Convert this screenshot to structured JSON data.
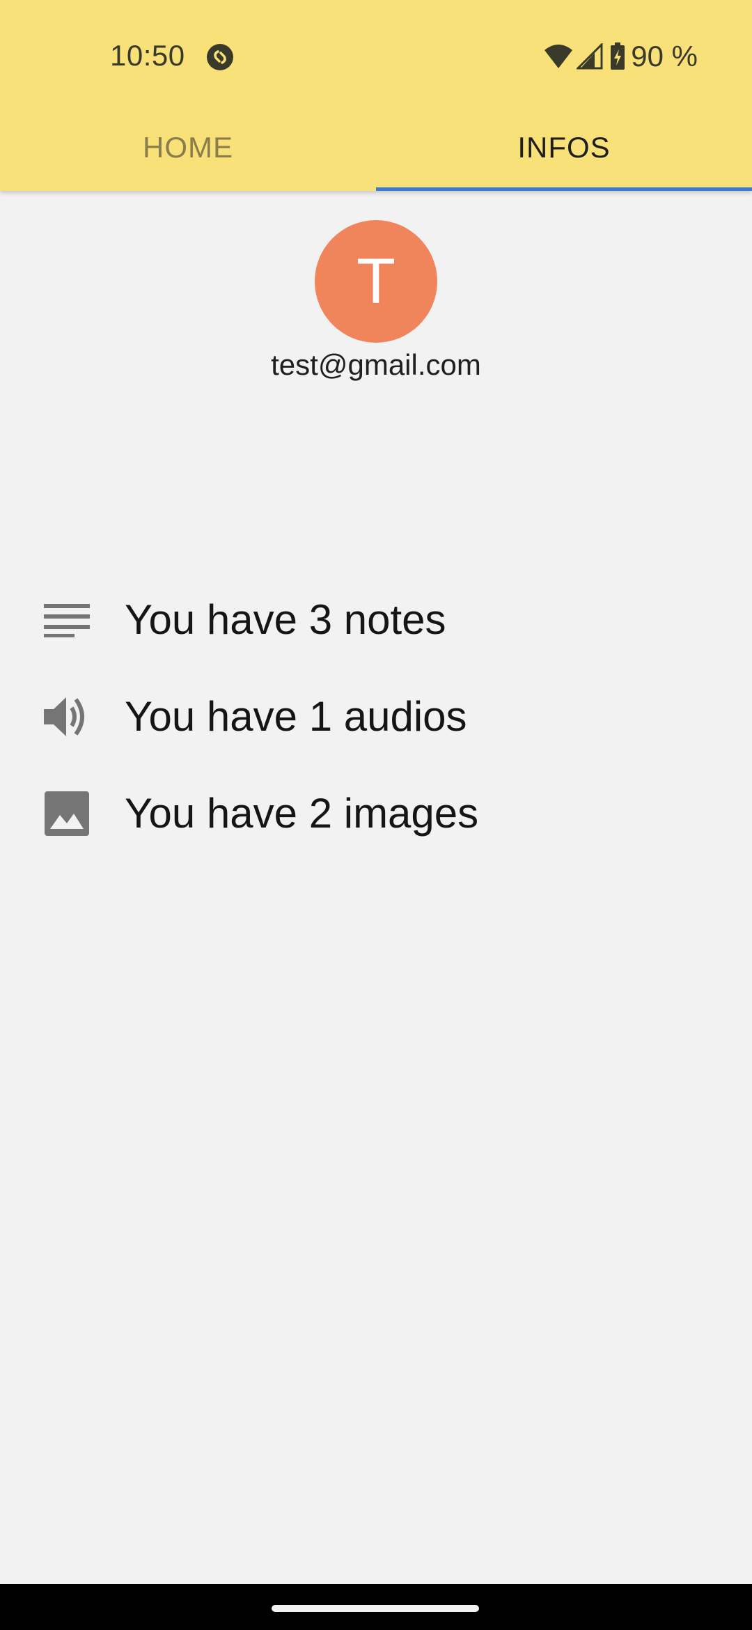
{
  "status_bar": {
    "time": "10:50",
    "battery": "90 %",
    "icons": [
      "shazam-icon",
      "wifi-icon",
      "signal-icon",
      "battery-charging-icon"
    ]
  },
  "tabs": [
    {
      "label": "HOME",
      "selected": false
    },
    {
      "label": "INFOS",
      "selected": true
    }
  ],
  "profile": {
    "avatar_letter": "T",
    "email": "test@gmail.com"
  },
  "stats": [
    {
      "icon": "notes-icon",
      "text": "You have 3 notes"
    },
    {
      "icon": "volume-icon",
      "text": "You have 1 audios"
    },
    {
      "icon": "image-icon",
      "text": "You have 2 images"
    }
  ],
  "colors": {
    "appbar": "#f9e179",
    "tab_indicator": "#3b7bd8",
    "avatar": "#f0855c",
    "background": "#f2f2f2",
    "icon": "#757575"
  }
}
